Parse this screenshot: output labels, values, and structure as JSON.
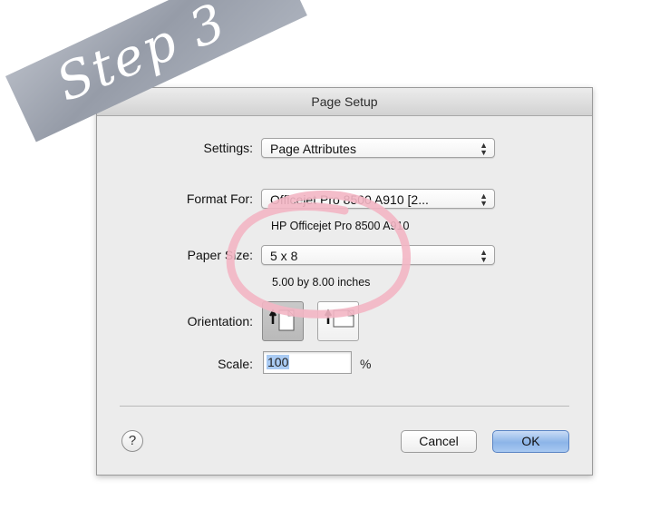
{
  "overlay": {
    "step_label": "Step 3",
    "tape_color": "#a4aab4",
    "circle_color": "#f3b6c4"
  },
  "dialog": {
    "title": "Page Setup",
    "settings": {
      "label": "Settings:",
      "value": "Page Attributes"
    },
    "format_for": {
      "label": "Format For:",
      "value": "Officejet Pro 8500 A910 [2...",
      "subtext": "HP Officejet Pro 8500 A910"
    },
    "paper_size": {
      "label": "Paper Size:",
      "value": "5 x 8",
      "subtext": "5.00 by 8.00 inches"
    },
    "orientation": {
      "label": "Orientation:",
      "selected": "portrait"
    },
    "scale": {
      "label": "Scale:",
      "value": "100",
      "unit": "%"
    },
    "buttons": {
      "help": "?",
      "cancel": "Cancel",
      "ok": "OK"
    },
    "accent_color": "#8cb4e8"
  }
}
